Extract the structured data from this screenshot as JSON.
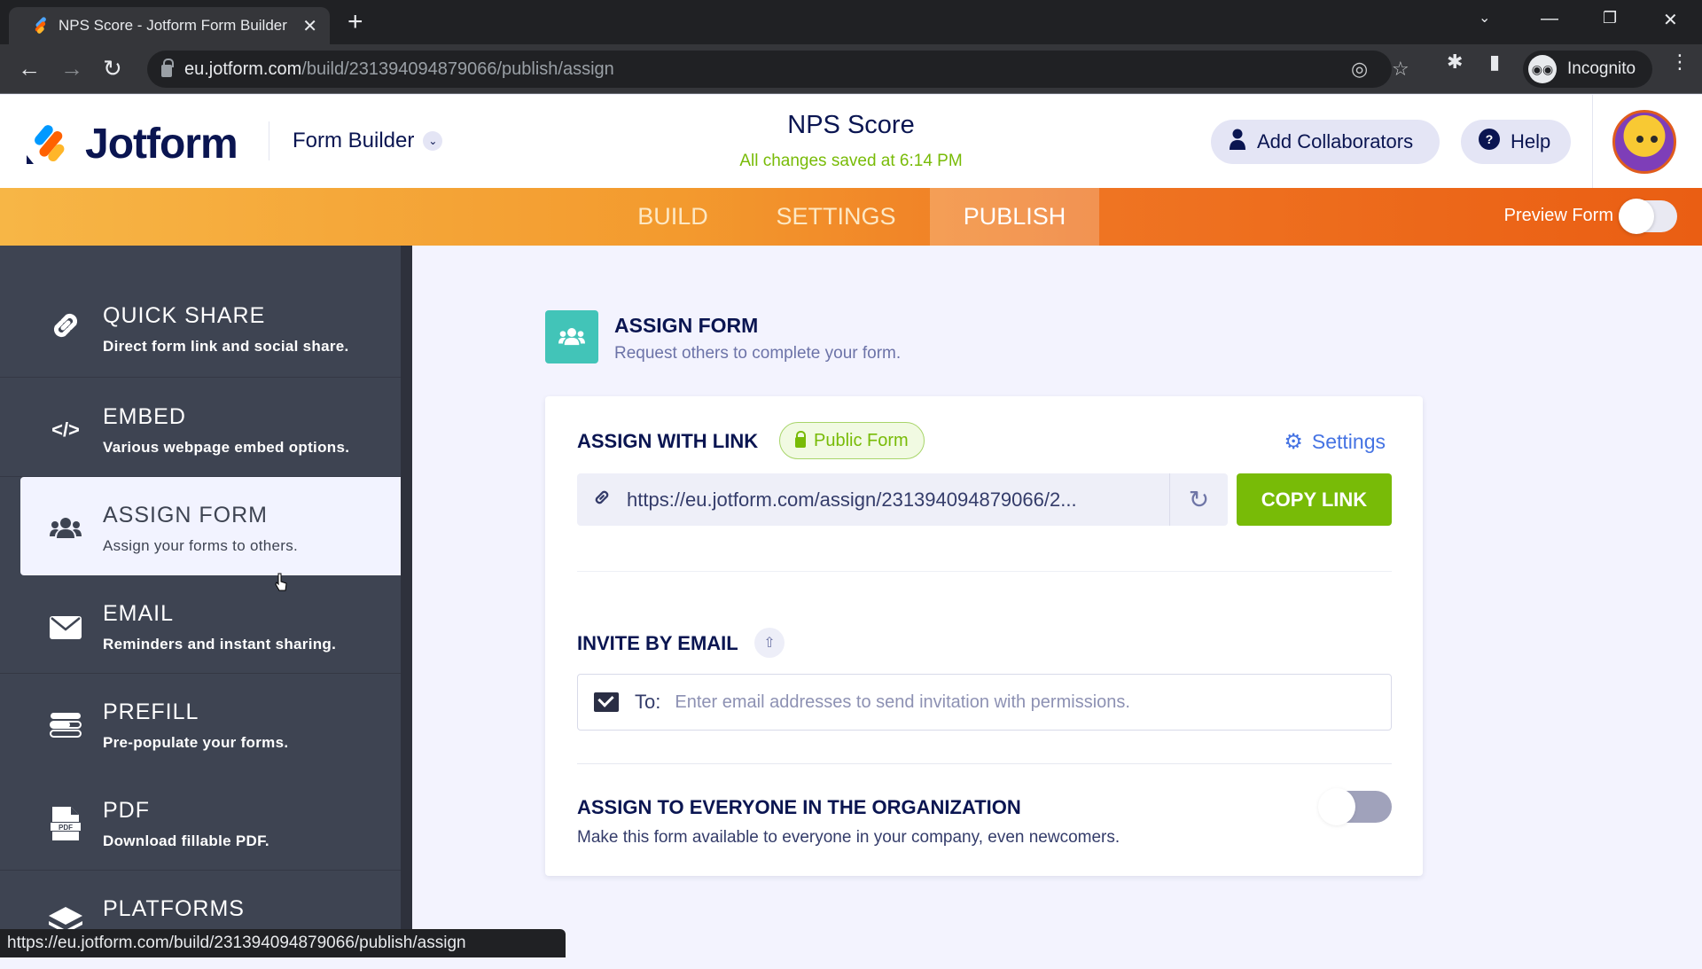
{
  "browser": {
    "tab_title": "NPS Score - Jotform Form Builder",
    "url_host": "eu.jotform.com",
    "url_path": "/build/231394094879066/publish/assign",
    "profile_label": "Incognito",
    "status_url": "https://eu.jotform.com/build/231394094879066/publish/assign"
  },
  "header": {
    "logo_text": "Jotform",
    "builder_menu": "Form Builder",
    "form_title": "NPS Score",
    "save_status": "All changes saved at 6:14 PM",
    "add_collaborators": "Add Collaborators",
    "help": "Help"
  },
  "tabs": [
    {
      "label": "BUILD",
      "active": false
    },
    {
      "label": "SETTINGS",
      "active": false
    },
    {
      "label": "PUBLISH",
      "active": true
    }
  ],
  "preview": {
    "label": "Preview Form",
    "enabled": false
  },
  "sidebar": {
    "items": [
      {
        "title": "QUICK SHARE",
        "desc": "Direct form link and social share.",
        "icon": "link-icon",
        "active": false
      },
      {
        "title": "EMBED",
        "desc": "Various webpage embed options.",
        "icon": "code-icon",
        "active": false
      },
      {
        "title": "ASSIGN FORM",
        "desc": "Assign your forms to others.",
        "icon": "users-icon",
        "active": true
      },
      {
        "title": "EMAIL",
        "desc": "Reminders and instant sharing.",
        "icon": "envelope-icon",
        "active": false
      },
      {
        "title": "PREFILL",
        "desc": "Pre-populate your forms.",
        "icon": "prefill-icon",
        "active": false
      },
      {
        "title": "PDF",
        "desc": "Download fillable PDF.",
        "icon": "pdf-icon",
        "active": false
      },
      {
        "title": "PLATFORMS",
        "desc": "",
        "icon": "layers-icon",
        "active": false
      }
    ]
  },
  "main": {
    "section_title": "ASSIGN FORM",
    "section_subtitle": "Request others to complete your form.",
    "assign_link": {
      "label": "ASSIGN WITH LINK",
      "badge": "Public Form",
      "settings_label": "Settings",
      "url": "https://eu.jotform.com/assign/231394094879066/2...",
      "copy_label": "COPY LINK"
    },
    "invite": {
      "label": "INVITE BY EMAIL",
      "to_label": "To:",
      "placeholder": "Enter email addresses to send invitation with permissions.",
      "value": ""
    },
    "org": {
      "title": "ASSIGN TO EVERYONE IN THE ORGANIZATION",
      "desc": "Make this form available to everyone in your company, even newcomers.",
      "enabled": false
    }
  },
  "colors": {
    "brand_navy": "#0a1551",
    "brand_orange": "#ef7422",
    "success_green": "#78bb07",
    "assign_teal": "#42c4b8",
    "sidebar_bg": "#3e4452",
    "link_blue": "#4573e3"
  }
}
